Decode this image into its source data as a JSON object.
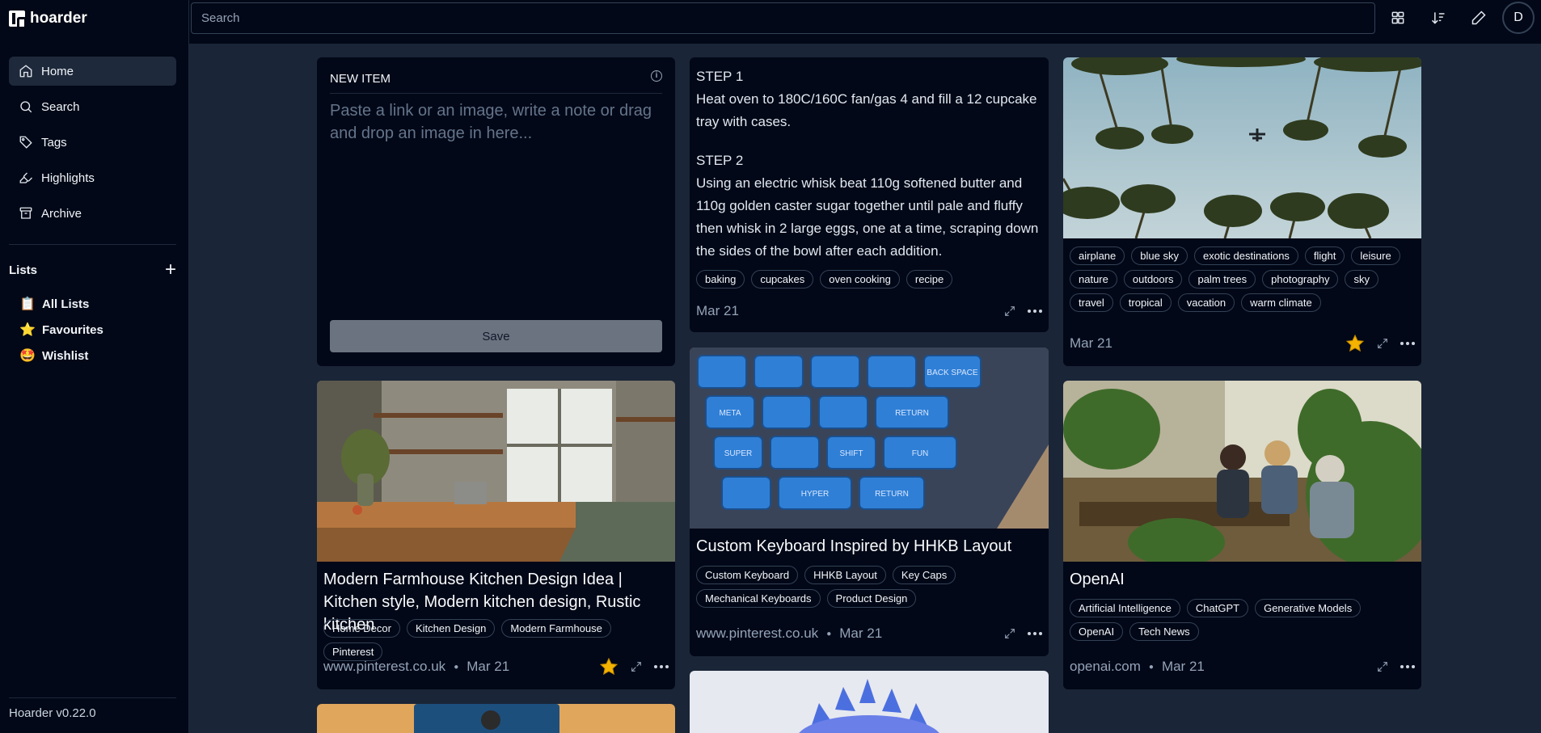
{
  "app": {
    "name": "hoarder",
    "version": "Hoarder v0.22.0"
  },
  "search": {
    "placeholder": "Search"
  },
  "user": {
    "initial": "D"
  },
  "nav": [
    {
      "label": "Home",
      "icon": "home-icon"
    },
    {
      "label": "Search",
      "icon": "search-icon"
    },
    {
      "label": "Tags",
      "icon": "tag-icon"
    },
    {
      "label": "Highlights",
      "icon": "highlighter-icon"
    },
    {
      "label": "Archive",
      "icon": "archive-icon"
    }
  ],
  "lists": {
    "title": "Lists",
    "items": [
      {
        "emoji": "📋",
        "label": "All Lists"
      },
      {
        "emoji": "⭐",
        "label": "Favourites"
      },
      {
        "emoji": "🤩",
        "label": "Wishlist"
      }
    ]
  },
  "new_item": {
    "title": "NEW ITEM",
    "placeholder": "Paste a link or an image, write a note or drag and drop an image in here...",
    "save_label": "Save"
  },
  "note_card": {
    "step1_title": "STEP 1",
    "step1_text": "Heat oven to 180C/160C fan/gas 4 and fill a 12 cupcake tray with cases.",
    "step2_title": "STEP 2",
    "step2_text": "Using an electric whisk beat 110g softened butter and 110g golden caster sugar together until pale and fluffy then whisk in 2 large eggs, one at a time, scraping down the sides of the bowl after each addition.",
    "tags": [
      "baking",
      "cupcakes",
      "oven cooking",
      "recipe"
    ],
    "date": "Mar 21"
  },
  "palm_card": {
    "tags": [
      "airplane",
      "blue sky",
      "exotic destinations",
      "flight",
      "leisure",
      "nature",
      "outdoors",
      "palm trees",
      "photography",
      "sky",
      "travel",
      "tropical",
      "vacation",
      "warm climate"
    ],
    "date": "Mar 21",
    "favourited": true
  },
  "kitchen_card": {
    "title": "Modern Farmhouse Kitchen Design Idea | Kitchen style, Modern kitchen design, Rustic kitchen",
    "tags": [
      "Home Decor",
      "Kitchen Design",
      "Modern Farmhouse",
      "Pinterest"
    ],
    "source": "www.pinterest.co.uk",
    "date": "Mar 21",
    "favourited": true
  },
  "keyboard_card": {
    "title": "Custom Keyboard Inspired by HHKB Layout",
    "tags": [
      "Custom Keyboard",
      "HHKB Layout",
      "Key Caps",
      "Mechanical Keyboards",
      "Product Design"
    ],
    "source": "www.pinterest.co.uk",
    "date": "Mar 21",
    "keycap_labels": [
      "BACK SPACE",
      "RETURN",
      "SHIFT",
      "FUN",
      "RETURN",
      "HYPER",
      "SUPER",
      "META"
    ]
  },
  "openai_card": {
    "title": "OpenAI",
    "tags": [
      "Artificial Intelligence",
      "ChatGPT",
      "Generative Models",
      "OpenAI",
      "Tech News"
    ],
    "source": "openai.com",
    "date": "Mar 21"
  }
}
